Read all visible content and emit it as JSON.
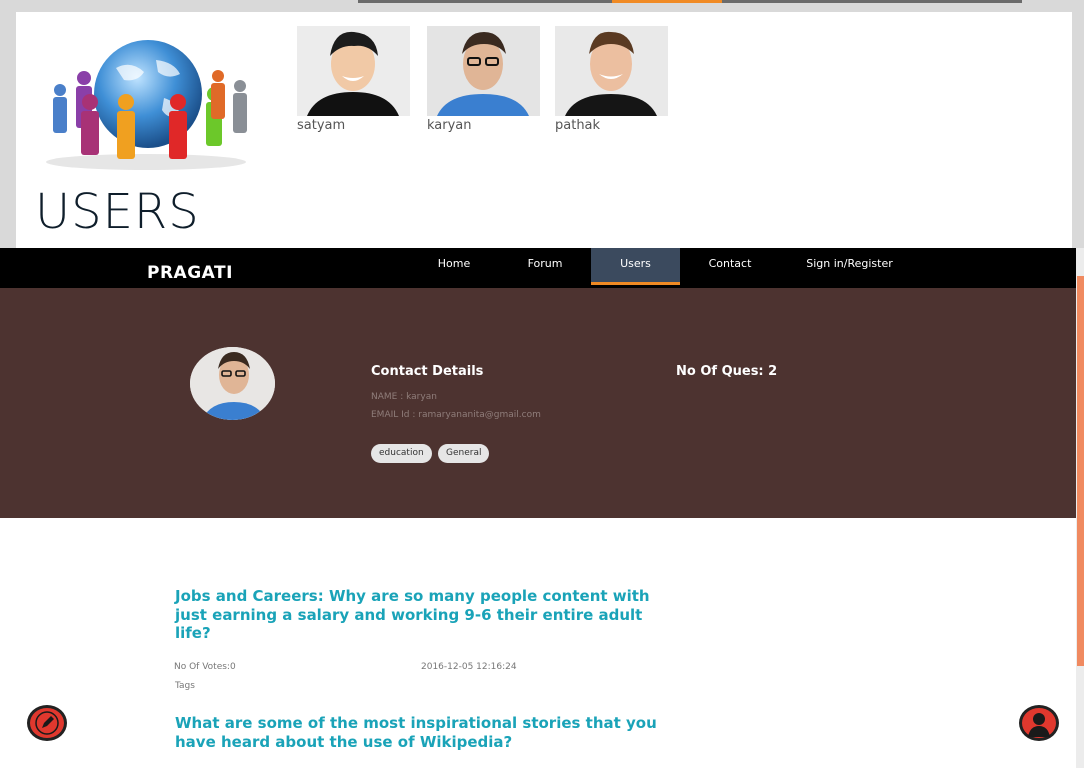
{
  "header": {
    "users": [
      {
        "name": "satyam"
      },
      {
        "name": "karyan"
      },
      {
        "name": "pathak"
      }
    ],
    "title": "USERS"
  },
  "navbar": {
    "brand": "PRAGATI",
    "items": [
      {
        "label": "Home"
      },
      {
        "label": "Forum"
      },
      {
        "label": "Users",
        "active": true
      },
      {
        "label": "Contact"
      },
      {
        "label": "Sign in/Register"
      }
    ]
  },
  "profile": {
    "contact_title": "Contact Details",
    "name_line": "NAME : karyan",
    "email_line": "EMAIL Id : ramaryananita@gmail.com",
    "tags": [
      "education",
      "General"
    ],
    "ques_count": "No Of Ques: 2"
  },
  "questions": [
    {
      "title": "Jobs and Careers: Why are so many people content with just earning a salary and working 9-6 their entire adult life?",
      "votes": "No Of Votes:0",
      "date": "2016-12-05 12:16:24",
      "tags_label": "Tags"
    },
    {
      "title": "What are some of the most inspirational stories that you have heard about the use of Wikipedia?"
    }
  ],
  "icons": {
    "left_fab": "pencil-icon",
    "right_fab": "user-icon"
  },
  "colors": {
    "accent": "#f08a24",
    "profile_bg": "#4d3330",
    "link": "#1aa3b8",
    "fab": "#e0382e"
  }
}
